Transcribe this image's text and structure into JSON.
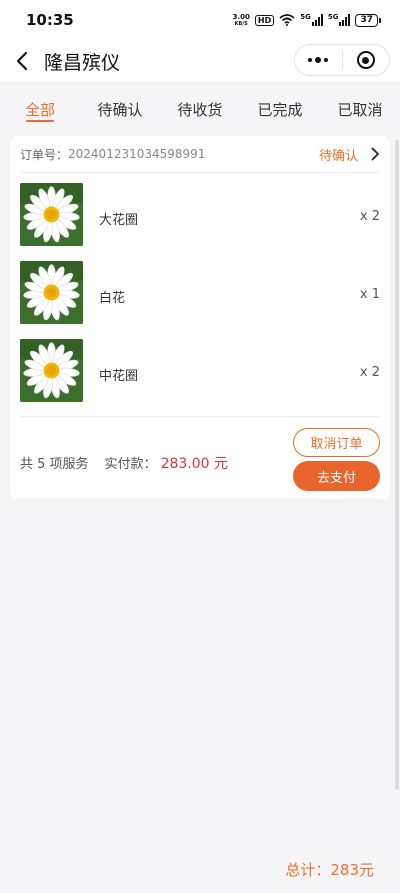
{
  "status_bar": {
    "time": "10:35",
    "net_speed_value": "3.00",
    "net_speed_unit": "KB/S",
    "hd": "HD",
    "signal1_label": "5G",
    "signal2_label": "5G",
    "battery": "37"
  },
  "nav": {
    "title": "隆昌殡仪",
    "icons": {
      "back": "chevron-left-icon",
      "more": "more-dots-icon",
      "close": "target-icon"
    }
  },
  "tabs": [
    {
      "label": "全部",
      "active": true
    },
    {
      "label": "待确认",
      "active": false
    },
    {
      "label": "待收货",
      "active": false
    },
    {
      "label": "已完成",
      "active": false
    },
    {
      "label": "已取消",
      "active": false
    }
  ],
  "order": {
    "no_label": "订单号：",
    "no": "202401231034598991",
    "status": "待确认",
    "items": [
      {
        "name": "大花圈",
        "qty": "x 2",
        "image": "daisy-flower"
      },
      {
        "name": "白花",
        "qty": "x 1",
        "image": "daisy-flower"
      },
      {
        "name": "中花圈",
        "qty": "x 2",
        "image": "daisy-flower"
      }
    ],
    "summary_count": "共 5 项服务",
    "paid_label": "实付款：",
    "paid_amount": "283.00 元",
    "cancel_label": "取消订单",
    "pay_label": "去支付"
  },
  "total": {
    "label": "总计：",
    "value": "283元"
  },
  "colors": {
    "accent": "#e8702e",
    "price": "#d9362e",
    "background": "#f5f5f7"
  }
}
